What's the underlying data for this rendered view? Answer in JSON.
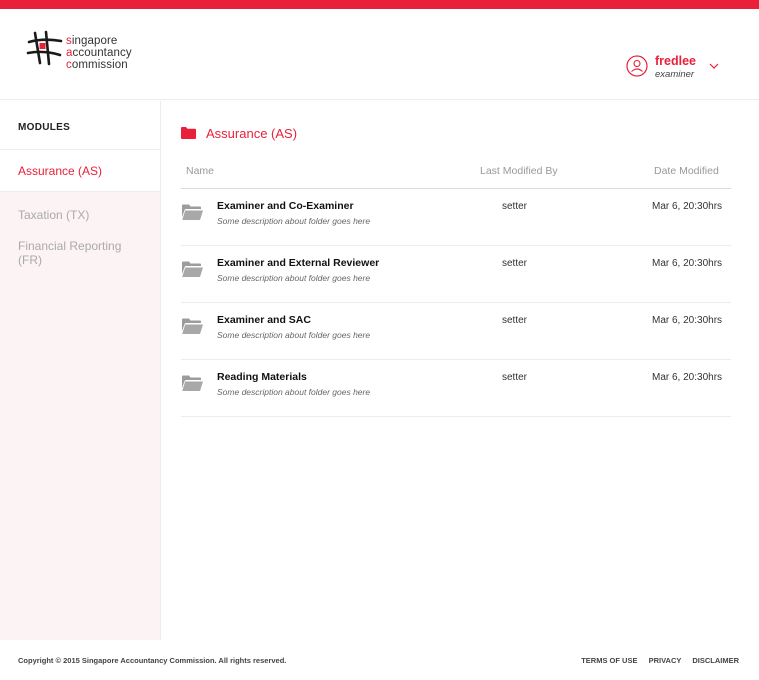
{
  "brand": {
    "accent_color": "#e8203a",
    "logo_line1_accent": "s",
    "logo_line1_rest": "ingapore",
    "logo_line2_accent": "a",
    "logo_line2_rest": "ccountancy",
    "logo_line3_accent": "c",
    "logo_line3_rest": "ommission"
  },
  "user": {
    "name": "fredlee",
    "role": "examiner",
    "icon": "user-icon",
    "menu_icon": "chevron-down-icon"
  },
  "sidebar": {
    "heading": "MODULES",
    "active": "Assurance (AS)",
    "items": [
      {
        "label": "Taxation (TX)"
      },
      {
        "label": "Financial Reporting (FR)"
      }
    ]
  },
  "main": {
    "title": "Assurance (AS)",
    "title_icon": "folder-icon",
    "columns": {
      "name": "Name",
      "modified_by": "Last Modified By",
      "date": "Date Modified"
    },
    "rows": [
      {
        "name": "Examiner and Co-Examiner",
        "description": "Some description about folder goes here",
        "modified_by": "setter",
        "date": "Mar 6, 20:30hrs",
        "icon": "folder-open-icon"
      },
      {
        "name": "Examiner and External Reviewer",
        "description": "Some description about folder goes here",
        "modified_by": "setter",
        "date": "Mar 6, 20:30hrs",
        "icon": "folder-open-icon"
      },
      {
        "name": "Examiner and SAC",
        "description": "Some description about folder goes here",
        "modified_by": "setter",
        "date": "Mar 6, 20:30hrs",
        "icon": "folder-open-icon"
      },
      {
        "name": "Reading Materials",
        "description": "Some description about folder goes here",
        "modified_by": "setter",
        "date": "Mar 6, 20:30hrs",
        "icon": "folder-open-icon"
      }
    ]
  },
  "footer": {
    "copyright": "Copyright © 2015 Singapore Accountancy Commission. All rights reserved.",
    "links": [
      "TERMS OF USE",
      "PRIVACY",
      "DISCLAIMER"
    ]
  }
}
